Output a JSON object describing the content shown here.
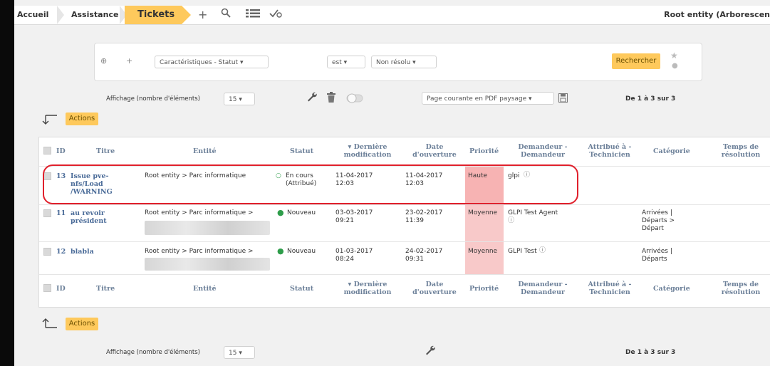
{
  "breadcrumb": {
    "home": "Accueil",
    "assistance": "Assistance",
    "tickets": "Tickets"
  },
  "top_icons": [
    "plus-icon",
    "search-icon",
    "list-icon",
    "check-icon"
  ],
  "entity_label": "Root entity (Arborescen",
  "search": {
    "field": "Caractéristiques - Statut",
    "operator": "est",
    "value": "Non résolu",
    "button": "Rechercher"
  },
  "pager": {
    "display_label": "Affichage (nombre d'éléments)",
    "display_value": "15",
    "export_option": "Page courante en PDF paysage",
    "range": "De 1 à 3 sur 3"
  },
  "actions_label": "Actions",
  "columns": [
    "ID",
    "Titre",
    "Entité",
    "Statut",
    "▾ Dernière modification",
    "Date d'ouverture",
    "Priorité",
    "Demandeur - Demandeur",
    "Attribué à - Technicien",
    "Catégorie",
    "Temps de résolution"
  ],
  "tickets": [
    {
      "id": "13",
      "title": "Issue pve-nfs/Load /WARNING",
      "entity": "Root entity > Parc informatique",
      "status": "En cours (Attribué)",
      "last_modified": "11-04-2017 12:03",
      "opened": "11-04-2017 12:03",
      "priority": "Haute",
      "requester": "glpi",
      "technician": "",
      "category": "",
      "resolution_time": ""
    },
    {
      "id": "11",
      "title": "au revoir président",
      "entity": "Root entity > Parc informatique >",
      "status": "Nouveau",
      "last_modified": "03-03-2017 09:21",
      "opened": "23-02-2017 11:39",
      "priority": "Moyenne",
      "requester": "GLPI Test Agent",
      "technician": "",
      "category": "Arrivées | Départs > Départ",
      "resolution_time": ""
    },
    {
      "id": "12",
      "title": "blabla",
      "entity": "Root entity > Parc informatique >",
      "status": "Nouveau",
      "last_modified": "01-03-2017 08:24",
      "opened": "24-02-2017 09:31",
      "priority": "Moyenne",
      "requester": "GLPI Test",
      "technician": "",
      "category": "Arrivées | Départs",
      "resolution_time": ""
    }
  ],
  "colors": {
    "accent": "#fec95c",
    "priority_high": "#f7b3b3",
    "status_new": "#2e9d4a",
    "highlight": "#e0202c"
  }
}
